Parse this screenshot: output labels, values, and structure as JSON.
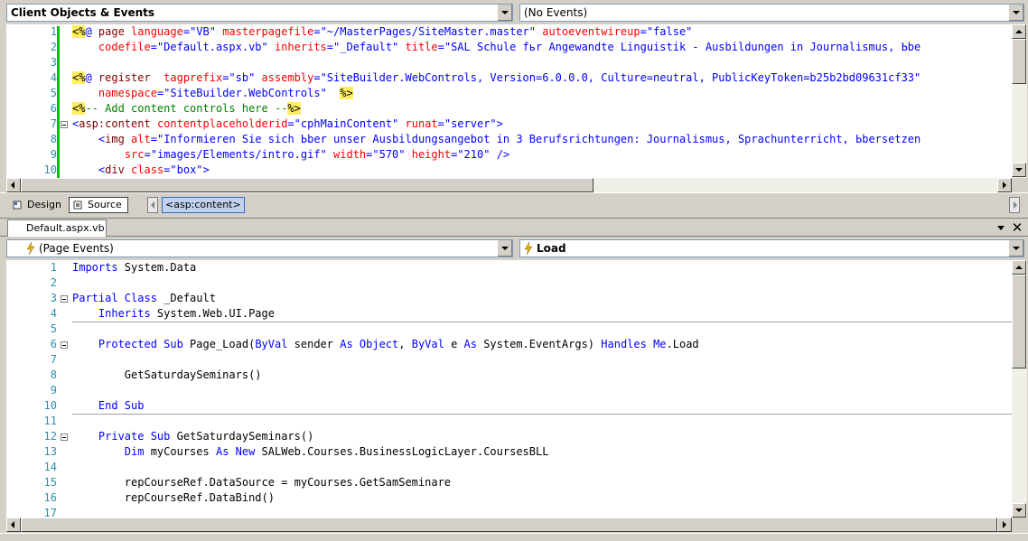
{
  "top": {
    "object_dropdown": "Client Objects & Events",
    "event_dropdown": "(No Events)"
  },
  "markup_lines": [
    {
      "n": "1",
      "parts": [
        [
          "hl",
          "<%"
        ],
        [
          "kw",
          "@ "
        ],
        [
          "tag",
          "page "
        ],
        [
          "at",
          "language"
        ],
        [
          "kw",
          "="
        ],
        [
          "str",
          "\"VB\" "
        ],
        [
          "at",
          "masterpagefile"
        ],
        [
          "kw",
          "="
        ],
        [
          "str",
          "\"~/MasterPages/SiteMaster.master\" "
        ],
        [
          "at",
          "autoeventwireup"
        ],
        [
          "kw",
          "="
        ],
        [
          "str",
          "\"false\""
        ]
      ]
    },
    {
      "n": "2",
      "parts": [
        [
          "pl",
          "    "
        ],
        [
          "at",
          "codefile"
        ],
        [
          "kw",
          "="
        ],
        [
          "str",
          "\"Default.aspx.vb\" "
        ],
        [
          "at",
          "inherits"
        ],
        [
          "kw",
          "="
        ],
        [
          "str",
          "\"_Default\" "
        ],
        [
          "at",
          "title"
        ],
        [
          "kw",
          "="
        ],
        [
          "str",
          "\"SAL Schule fьr Angewandte Linguistik - Ausbildungen in Journalismus, Ьbe"
        ]
      ]
    },
    {
      "n": "3",
      "parts": []
    },
    {
      "n": "4",
      "parts": [
        [
          "hl",
          "<%"
        ],
        [
          "kw",
          "@ "
        ],
        [
          "tag",
          "register  "
        ],
        [
          "at",
          "tagprefix"
        ],
        [
          "kw",
          "="
        ],
        [
          "str",
          "\"sb\" "
        ],
        [
          "at",
          "assembly"
        ],
        [
          "kw",
          "="
        ],
        [
          "str",
          "\"SiteBuilder.WebControls, Version=6.0.0.0, Culture=neutral, PublicKeyToken=b25b2bd09631cf33\""
        ]
      ]
    },
    {
      "n": "5",
      "parts": [
        [
          "pl",
          "    "
        ],
        [
          "at",
          "namespace"
        ],
        [
          "kw",
          "="
        ],
        [
          "str",
          "\"SiteBuilder.WebControls\"  "
        ],
        [
          "hl",
          "%>"
        ]
      ]
    },
    {
      "n": "6",
      "parts": [
        [
          "hl",
          "<%"
        ],
        [
          "cm",
          "-- Add content controls here --"
        ],
        [
          "hl",
          "%>"
        ]
      ]
    },
    {
      "n": "7",
      "parts": [
        [
          "kw",
          "<"
        ],
        [
          "tag",
          "asp:content "
        ],
        [
          "at",
          "contentplaceholderid"
        ],
        [
          "kw",
          "="
        ],
        [
          "str",
          "\"cphMainContent\" "
        ],
        [
          "at",
          "runat"
        ],
        [
          "kw",
          "="
        ],
        [
          "str",
          "\"server\""
        ],
        [
          "kw",
          ">"
        ]
      ]
    },
    {
      "n": "8",
      "parts": [
        [
          "pl",
          "    "
        ],
        [
          "kw",
          "<"
        ],
        [
          "tag",
          "img "
        ],
        [
          "at",
          "alt"
        ],
        [
          "kw",
          "="
        ],
        [
          "str",
          "\"Informieren Sie sich Ьber unser Ausbildungsangebot in 3 Berufsrichtungen: Journalismus, Sprachunterricht, Ьbersetzen"
        ]
      ]
    },
    {
      "n": "9",
      "parts": [
        [
          "pl",
          "        "
        ],
        [
          "at",
          "src"
        ],
        [
          "kw",
          "="
        ],
        [
          "str",
          "\"images/Elements/intro.gif\" "
        ],
        [
          "at",
          "width"
        ],
        [
          "kw",
          "="
        ],
        [
          "str",
          "\"570\" "
        ],
        [
          "at",
          "height"
        ],
        [
          "kw",
          "="
        ],
        [
          "str",
          "\"210\" "
        ],
        [
          "kw",
          "/>"
        ]
      ]
    },
    {
      "n": "10",
      "parts": [
        [
          "pl",
          "    "
        ],
        [
          "kw",
          "<"
        ],
        [
          "tag",
          "div "
        ],
        [
          "at",
          "class"
        ],
        [
          "kw",
          "="
        ],
        [
          "str",
          "\"box\""
        ],
        [
          "kw",
          ">"
        ]
      ]
    }
  ],
  "view_bar": {
    "design_label": "Design",
    "source_label": "Source",
    "breadcrumb_tag": "<asp:content>"
  },
  "doc_tab": "Default.aspx.vb",
  "code_dropdowns": {
    "object": "(Page Events)",
    "event": "Load"
  },
  "vb_lines": [
    {
      "n": "1",
      "parts": [
        [
          "kw",
          "Imports"
        ],
        [
          "pl",
          " System.Data"
        ]
      ]
    },
    {
      "n": "2",
      "parts": []
    },
    {
      "n": "3",
      "parts": [
        [
          "kw",
          "Partial Class"
        ],
        [
          "pl",
          " _Default"
        ]
      ]
    },
    {
      "n": "4",
      "parts": [
        [
          "pl",
          "    "
        ],
        [
          "kw",
          "Inherits"
        ],
        [
          "pl",
          " System.Web.UI.Page"
        ]
      ]
    },
    {
      "n": "5",
      "parts": []
    },
    {
      "n": "6",
      "parts": [
        [
          "pl",
          "    "
        ],
        [
          "kw",
          "Protected Sub"
        ],
        [
          "pl",
          " Page_Load("
        ],
        [
          "kw",
          "ByVal"
        ],
        [
          "pl",
          " sender "
        ],
        [
          "kw",
          "As Object"
        ],
        [
          "pl",
          ", "
        ],
        [
          "kw",
          "ByVal"
        ],
        [
          "pl",
          " e "
        ],
        [
          "kw",
          "As"
        ],
        [
          "pl",
          " System.EventArgs) "
        ],
        [
          "kw",
          "Handles Me"
        ],
        [
          "pl",
          ".Load"
        ]
      ]
    },
    {
      "n": "7",
      "parts": []
    },
    {
      "n": "8",
      "parts": [
        [
          "pl",
          "        GetSaturdaySeminars()"
        ]
      ]
    },
    {
      "n": "9",
      "parts": []
    },
    {
      "n": "10",
      "parts": [
        [
          "pl",
          "    "
        ],
        [
          "kw",
          "End Sub"
        ]
      ]
    },
    {
      "n": "11",
      "parts": []
    },
    {
      "n": "12",
      "parts": [
        [
          "pl",
          "    "
        ],
        [
          "kw",
          "Private Sub"
        ],
        [
          "pl",
          " GetSaturdaySeminars()"
        ]
      ]
    },
    {
      "n": "13",
      "parts": [
        [
          "pl",
          "        "
        ],
        [
          "kw",
          "Dim"
        ],
        [
          "pl",
          " myCourses "
        ],
        [
          "kw",
          "As New"
        ],
        [
          "pl",
          " SALWeb.Courses.BusinessLogicLayer.CoursesBLL"
        ]
      ]
    },
    {
      "n": "14",
      "parts": []
    },
    {
      "n": "15",
      "parts": [
        [
          "pl",
          "        repCourseRef.DataSource = myCourses.GetSamSeminare"
        ]
      ]
    },
    {
      "n": "16",
      "parts": [
        [
          "pl",
          "        repCourseRef.DataBind()"
        ]
      ]
    },
    {
      "n": "17",
      "parts": []
    }
  ],
  "colors": {
    "keyword": "#0000ff",
    "attribute": "#ff0000",
    "tag": "#800000",
    "comment": "#008000",
    "line_number": "#2b91af",
    "directive_highlight": "#ffee62"
  }
}
